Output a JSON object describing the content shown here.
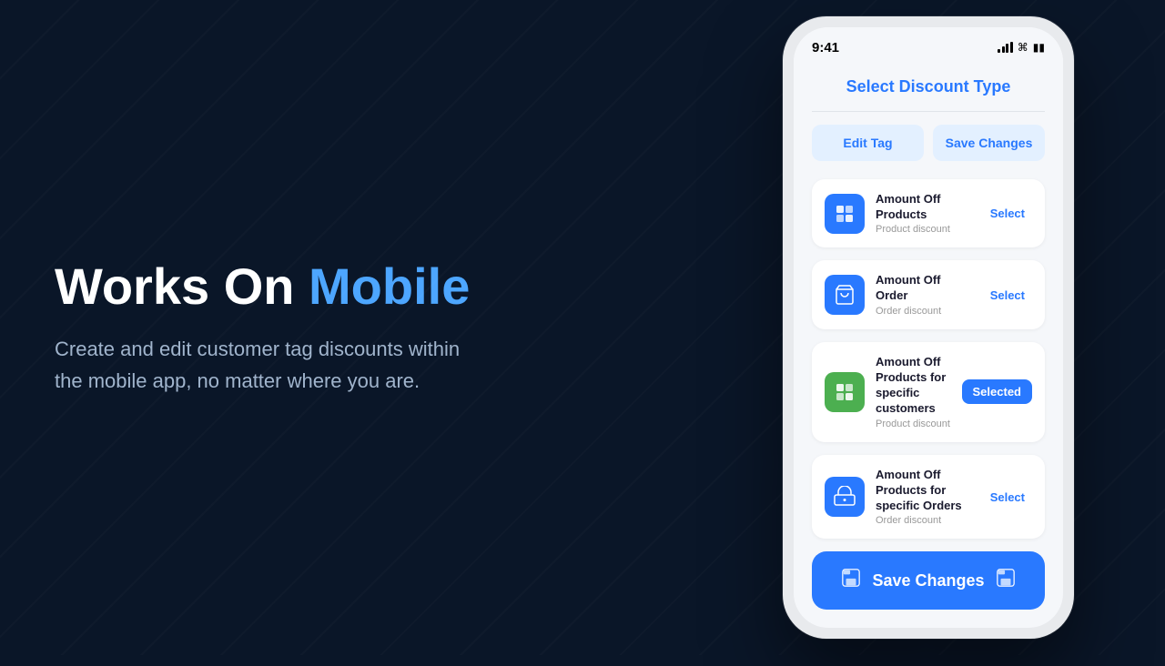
{
  "hero": {
    "title_plain": "Works On ",
    "title_accent": "Mobile",
    "subtitle": "Create and edit customer tag discounts within the mobile app, no matter where you are."
  },
  "phone": {
    "status_bar": {
      "time": "9:41"
    },
    "screen_title": "Select Discount Type",
    "buttons": {
      "edit_tag": "Edit Tag",
      "save_changes_top": "Save Changes"
    },
    "discount_items": [
      {
        "name": "Amount Off Products",
        "sub": "Product discount",
        "icon_type": "blue",
        "icon_emoji": "📦",
        "action": "Select",
        "selected": false
      },
      {
        "name": "Amount Off Order",
        "sub": "Order discount",
        "icon_type": "blue",
        "icon_emoji": "🛒",
        "action": "Select",
        "selected": false
      },
      {
        "name": "Amount Off Products for specific customers",
        "sub": "Product discount",
        "icon_type": "green",
        "icon_emoji": "📦",
        "action": "Selected",
        "selected": true
      },
      {
        "name": "Amount Off Products for specific Orders",
        "sub": "Order discount",
        "icon_type": "blue",
        "icon_emoji": "🚚",
        "action": "Select",
        "selected": false
      }
    ],
    "save_button": "Save Changes"
  }
}
